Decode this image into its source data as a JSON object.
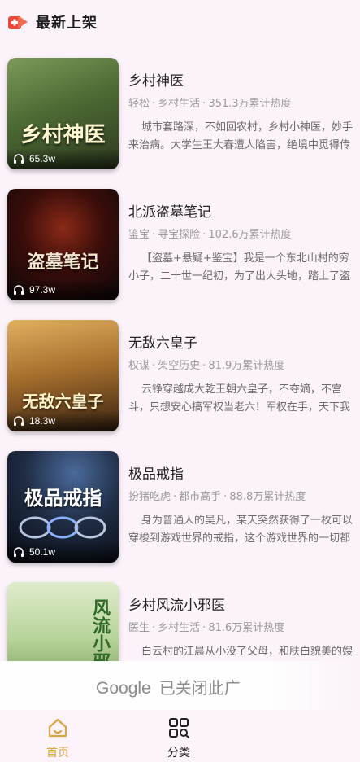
{
  "header": {
    "title": "最新上架"
  },
  "books": [
    {
      "title": "乡村神医",
      "tag": "轻松",
      "category": "乡村生活",
      "heat": "351.3万累计热度",
      "desc": "城市套路深，不如回农村，乡村小神医，妙手来治病。大学生王大春遭人陷害，绝境中觅得传承，从此走上致富之路。",
      "plays": "65.3w",
      "cover_title": "乡村神医",
      "cover_colors": [
        "#6f8a4a",
        "#2d3a1f"
      ]
    },
    {
      "title": "北派盗墓笔记",
      "tag": "鉴宝",
      "category": "寻宝探险",
      "heat": "102.6万累计热度",
      "desc": "【盗墓+悬疑+鉴宝】我是一个东北山村的穷小子，二十世一纪初，为了出人头地，踏上了盗墓这条不归路。",
      "plays": "97.3w",
      "cover_title": "盗墓笔记",
      "cover_colors": [
        "#5a1410",
        "#0c0808"
      ]
    },
    {
      "title": "无敌六皇子",
      "tag": "权谋",
      "category": "架空历史",
      "heat": "81.9万累计热度",
      "desc": "云铮穿越成大乾王朝六皇子，不夺嫡，不宫斗，只想安心搞军权当老六！军权在手，天下我有。",
      "plays": "18.3w",
      "cover_title": "无敌六皇子",
      "cover_colors": [
        "#c48a3a",
        "#3a2412"
      ]
    },
    {
      "title": "极品戒指",
      "tag": "扮猪吃虎",
      "category": "都市高手",
      "heat": "88.8万累计热度",
      "desc": "身为普通人的吴凡，某天突然获得了一枚可以穿梭到游戏世界的戒指，这个游戏世界的一切都可以带回现实。",
      "plays": "50.1w",
      "cover_title": "极品戒指",
      "cover_colors": [
        "#1f2c44",
        "#07090f"
      ]
    },
    {
      "title": "乡村风流小邪医",
      "tag": "医生",
      "category": "乡村生活",
      "heat": "81.6万累计热度",
      "desc": "白云村的江晨从小没了父母，和肤白貌美的嫂子相依为命。",
      "plays": "",
      "cover_title": "风流小邪医",
      "cover_colors": [
        "#cfe3b8",
        "#7a9a5a"
      ]
    }
  ],
  "ad": {
    "brand": "Google",
    "text": "已关闭此广"
  },
  "nav": {
    "home": "首页",
    "category": "分类",
    "active_color": "#d9a441"
  }
}
